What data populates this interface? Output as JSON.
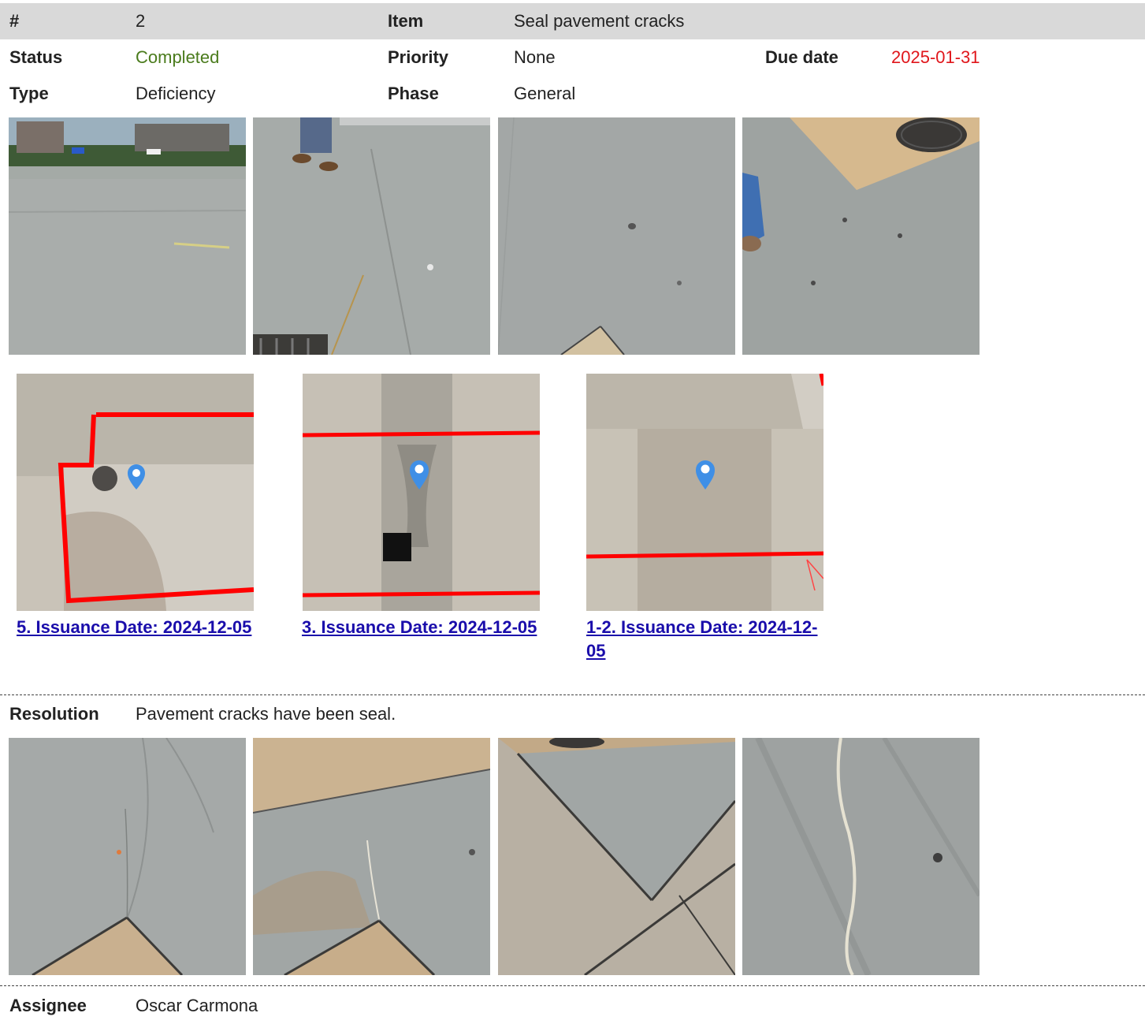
{
  "header": {
    "num_label": "#",
    "num_value": "2",
    "item_label": "Item",
    "item_value": "Seal pavement cracks"
  },
  "row2": {
    "status_label": "Status",
    "status_value": "Completed",
    "priority_label": "Priority",
    "priority_value": "None",
    "due_label": "Due date",
    "due_value": "2025-01-31"
  },
  "row3": {
    "type_label": "Type",
    "type_value": "Deficiency",
    "phase_label": "Phase",
    "phase_value": "General"
  },
  "maps": [
    {
      "caption_line1": "5. Issuance Date: 2024-12-05",
      "caption_line2": ""
    },
    {
      "caption_line1": "3. Issuance Date: 2024-12-05",
      "caption_line2": ""
    },
    {
      "caption_line1": "1-2. Issuance Date: 2024-12-",
      "caption_line2": "05"
    }
  ],
  "resolution": {
    "label": "Resolution",
    "value": "Pavement cracks have been seal."
  },
  "assignee": {
    "label": "Assignee",
    "value": "Oscar Carmona"
  },
  "colors": {
    "status": "#4a7b1c",
    "due": "#e0161b",
    "link": "#1a0dab",
    "header_band": "#d9d9d9",
    "map_outline": "#ff0000",
    "pin": "#3f8fe6"
  }
}
